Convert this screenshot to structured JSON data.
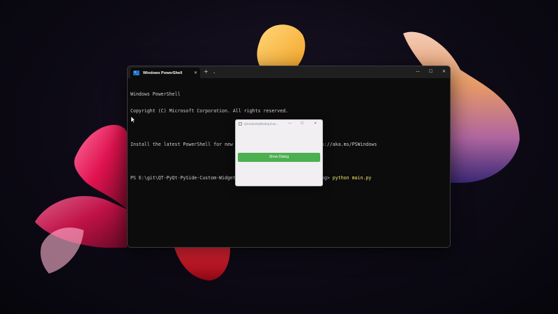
{
  "terminal": {
    "tab_title": "Windows PowerShell",
    "tab_close": "✕",
    "new_tab": "+",
    "tab_dropdown": "⌄",
    "minimize": "—",
    "maximize": "☐",
    "close": "✕",
    "lines": [
      "Windows PowerShell",
      "Copyright (C) Microsoft Corporation. All rights reserved.",
      "",
      "Install the latest PowerShell for new features and improvements! https://aka.ms/PSWindows",
      "",
      "PS E:\\git\\QT-PyQt-PySide-Custom-Widgets\\examples\\PySide6\\QCustomQDialog> "
    ],
    "command": "python main.py"
  },
  "dialog": {
    "title": "QCustomQDialog Exa...",
    "minimize": "—",
    "maximize": "☐",
    "close": "✕",
    "button_label": "Show Dialog"
  },
  "colors": {
    "terminal_bg": "#0c0c0c",
    "terminal_text": "#cccccc",
    "command_text": "#f2e26b",
    "button_green": "#4caf50",
    "dialog_bg": "#f1eff2"
  },
  "icons": [
    "powershell-icon",
    "mouse-cursor-icon",
    "app-window-icon"
  ]
}
